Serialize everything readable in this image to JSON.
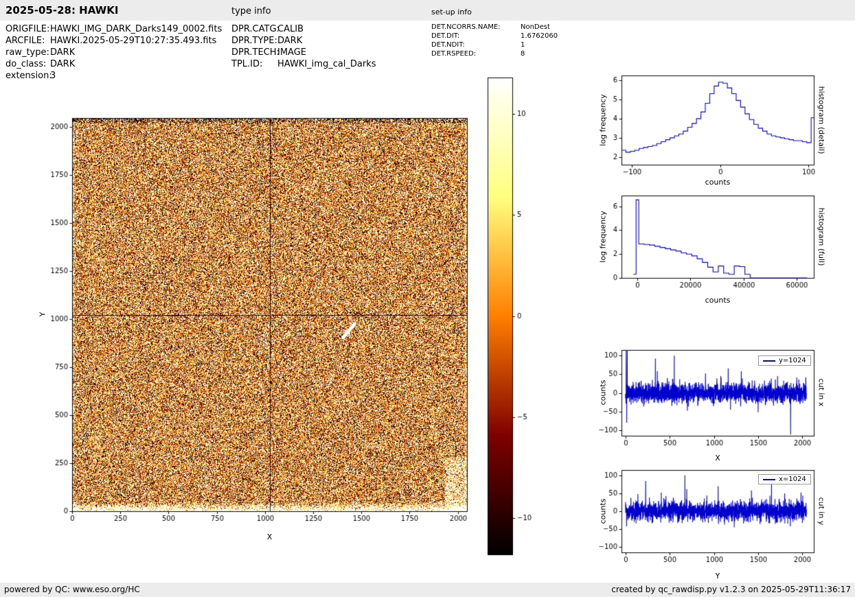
{
  "header": {
    "title": "2025-05-28: HAWKI",
    "type_info_label": "type info",
    "setup_info_label": "set-up info"
  },
  "metadata": {
    "left": [
      {
        "key": "ORIGFILE:",
        "value": "HAWKI_IMG_DARK_Darks149_0002.fits"
      },
      {
        "key": "ARCFILE:",
        "value": "HAWKI.2025-05-29T10:27:35.493.fits"
      },
      {
        "key": "raw_type:",
        "value": "DARK"
      },
      {
        "key": "do_class:",
        "value": "DARK"
      },
      {
        "key": "extension:",
        "value": "3"
      }
    ],
    "type_info": [
      {
        "key": "DPR.CATG:",
        "value": "CALIB"
      },
      {
        "key": "DPR.TYPE:",
        "value": "DARK"
      },
      {
        "key": "DPR.TECH:",
        "value": "IMAGE"
      },
      {
        "key": "TPL.ID:",
        "value": "HAWKI_img_cal_Darks"
      }
    ],
    "setup_info": [
      {
        "key": "DET.NCORRS.NAME:",
        "value": "NonDest"
      },
      {
        "key": "DET.DIT:",
        "value": "1.6762060"
      },
      {
        "key": "DET.NDIT:",
        "value": "1"
      },
      {
        "key": "DET.RSPEED:",
        "value": "8"
      }
    ]
  },
  "footer": {
    "left": "powered by QC: www.eso.org/HC",
    "right": "created by qc_rawdisp.py v1.2.3 on 2025-05-29T11:36:17"
  },
  "colors": {
    "bar_bg": "#ececec",
    "plot_line": "#0000cc",
    "crosshair": "#000080"
  },
  "colorbar": {
    "vmin": -11.8,
    "vmax": 11.8,
    "ticks": [
      10,
      5,
      0,
      -5,
      -10
    ],
    "gradient": [
      "#000000",
      "#800000",
      "#ff8000",
      "#ffff80",
      "#ffffff"
    ]
  },
  "chart_data": [
    {
      "id": "main_image",
      "type": "heatmap",
      "xlabel": "X",
      "ylabel": "Y",
      "xlim": [
        0,
        2048
      ],
      "ylim": [
        0,
        2048
      ],
      "xticks": [
        0,
        250,
        500,
        750,
        1000,
        1250,
        1500,
        1750,
        2000
      ],
      "yticks": [
        0,
        250,
        500,
        750,
        1000,
        1250,
        1500,
        1750,
        2000
      ],
      "colormap": "afmhot",
      "vmin": -11.8,
      "vmax": 11.8,
      "crosshair": {
        "x": 1024,
        "y": 1024
      },
      "noise": {
        "mean": 1.2,
        "std": 9,
        "seed": 5
      },
      "features": {
        "bright_bottom_rows": 45,
        "dark_top_rows": 25,
        "bright_right_column": {
          "x_min": 1935,
          "y_max": 280
        },
        "white_streak": {
          "x1": 1405,
          "y1": 905,
          "x2": 1465,
          "y2": 975
        }
      }
    },
    {
      "id": "hist_detail",
      "type": "line",
      "step": true,
      "xlabel": "counts",
      "ylabel": "log frequency",
      "right_label": "histogram (detail)",
      "xlim": [
        -112,
        106
      ],
      "ylim": [
        1.6,
        6.25
      ],
      "xticks": [
        -100,
        0,
        100
      ],
      "yticks": [
        2,
        3,
        4,
        5,
        6
      ],
      "x": [
        -112,
        -107,
        -102,
        -97,
        -92,
        -87,
        -82,
        -77,
        -72,
        -67,
        -62,
        -57,
        -52,
        -47,
        -42,
        -37,
        -32,
        -27,
        -22,
        -17,
        -12,
        -7,
        -2,
        3,
        8,
        13,
        18,
        23,
        28,
        33,
        38,
        43,
        48,
        53,
        58,
        63,
        68,
        73,
        78,
        83,
        88,
        93,
        98,
        103,
        108
      ],
      "y": [
        2.35,
        2.25,
        2.3,
        2.35,
        2.45,
        2.5,
        2.55,
        2.6,
        2.7,
        2.8,
        2.9,
        3.0,
        3.1,
        3.2,
        3.35,
        3.55,
        3.75,
        4.0,
        4.35,
        4.8,
        5.3,
        5.7,
        5.9,
        5.85,
        5.6,
        5.3,
        4.95,
        4.6,
        4.25,
        3.95,
        3.7,
        3.5,
        3.35,
        3.2,
        3.1,
        3.05,
        3.0,
        2.95,
        2.9,
        2.85,
        2.85,
        2.8,
        2.75,
        4.05,
        2.9
      ]
    },
    {
      "id": "hist_full",
      "type": "line",
      "step": true,
      "xlabel": "counts",
      "ylabel": "log frequency",
      "right_label": "histogram (full)",
      "xlim": [
        -6000,
        66500
      ],
      "ylim": [
        0,
        6.9
      ],
      "xticks": [
        0,
        20000,
        40000,
        60000
      ],
      "yticks": [
        0,
        2,
        4,
        6
      ],
      "x": [
        -1500,
        -500,
        500,
        2500,
        4500,
        6500,
        8500,
        10500,
        12500,
        14500,
        16500,
        18500,
        20500,
        22500,
        24500,
        26500,
        28500,
        30500,
        32500,
        34500,
        36500,
        38500,
        40500,
        42500,
        64000
      ],
      "y": [
        0.3,
        6.55,
        2.85,
        2.8,
        2.75,
        2.65,
        2.55,
        2.45,
        2.35,
        2.25,
        2.1,
        2.0,
        1.85,
        1.6,
        1.3,
        0.9,
        0.5,
        1.0,
        0.4,
        0.3,
        1.0,
        0.95,
        0.3,
        0.0,
        0.0
      ]
    },
    {
      "id": "cut_x",
      "type": "line",
      "xlabel": "X",
      "ylabel": "counts",
      "right_label": "cut in x",
      "legend": "y=1024",
      "xlim": [
        -45,
        2130
      ],
      "ylim": [
        -115,
        115
      ],
      "xticks": [
        0,
        500,
        1000,
        1500,
        2000
      ],
      "yticks": [
        -100,
        -50,
        0,
        50,
        100
      ],
      "noise": {
        "n": 2048,
        "std": 13,
        "seed": 11,
        "spikes": [
          [
            8,
            118
          ],
          [
            14,
            -80
          ],
          [
            20,
            125
          ],
          [
            338,
            92
          ],
          [
            360,
            58
          ],
          [
            552,
            100
          ],
          [
            700,
            -48
          ],
          [
            905,
            52
          ],
          [
            1162,
            66
          ],
          [
            1310,
            58
          ],
          [
            1500,
            -52
          ],
          [
            1720,
            45
          ],
          [
            1868,
            -112
          ],
          [
            2040,
            42
          ]
        ]
      }
    },
    {
      "id": "cut_y",
      "type": "line",
      "xlabel": "Y",
      "ylabel": "counts",
      "right_label": "cut in y",
      "legend": "x=1024",
      "xlim": [
        -45,
        2130
      ],
      "ylim": [
        -115,
        115
      ],
      "xticks": [
        0,
        500,
        1000,
        1500,
        2000
      ],
      "yticks": [
        -100,
        -50,
        0,
        50,
        100
      ],
      "noise": {
        "n": 2048,
        "std": 13,
        "seed": 23,
        "spikes": [
          [
            12,
            -42
          ],
          [
            140,
            48
          ],
          [
            228,
            85
          ],
          [
            405,
            52
          ],
          [
            672,
            100
          ],
          [
            693,
            62
          ],
          [
            1048,
            70
          ],
          [
            1230,
            -45
          ],
          [
            1425,
            58
          ],
          [
            1652,
            80
          ],
          [
            1800,
            50
          ],
          [
            1985,
            52
          ]
        ]
      }
    }
  ]
}
